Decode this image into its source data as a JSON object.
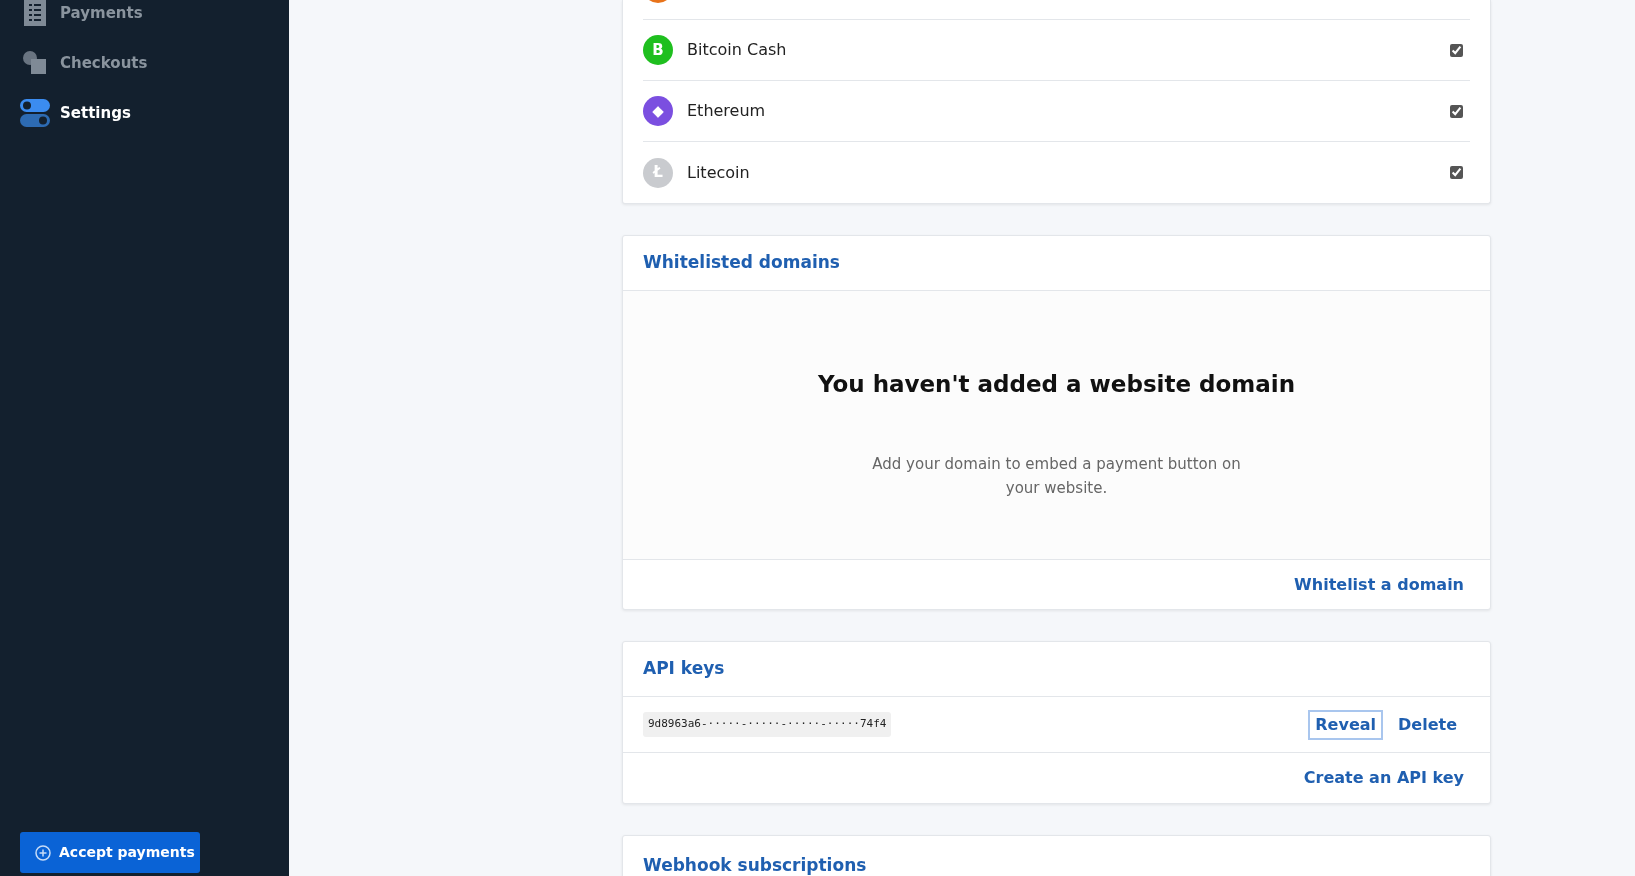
{
  "sidebar": {
    "items": [
      {
        "label": "Payments",
        "kind": "list",
        "selected": false
      },
      {
        "label": "Checkouts",
        "kind": "squares",
        "selected": false
      },
      {
        "label": "Settings",
        "kind": "toggles",
        "selected": true
      }
    ],
    "action": {
      "label": "Accept payments"
    }
  },
  "currencies": [
    {
      "kind": "cut",
      "color": "#e8731a"
    },
    {
      "kind": "row",
      "name": "Bitcoin Cash",
      "symbol": "B",
      "color": "#1fbf1f",
      "checked": true
    },
    {
      "kind": "row",
      "name": "Ethereum",
      "symbol": "◆",
      "color": "#7b4fe0",
      "checked": true
    },
    {
      "kind": "row",
      "name": "Litecoin",
      "symbol": "Ł",
      "color": "#c9cbcf",
      "checked": true
    }
  ],
  "whitelisted_domains": {
    "title": "Whitelisted domains",
    "empty_title": "You haven't added a website domain",
    "empty_text": "Add your domain to embed a payment button on your website.",
    "action": "Whitelist a domain"
  },
  "api_keys": {
    "title": "API keys",
    "keys": [
      {
        "value": "9d8963a6-·····-·····-·····-·····74f4",
        "actions": [
          "Reveal",
          "Delete"
        ]
      }
    ],
    "action": "Create an API key"
  },
  "webhooks": {
    "title": "Webhook subscriptions"
  }
}
